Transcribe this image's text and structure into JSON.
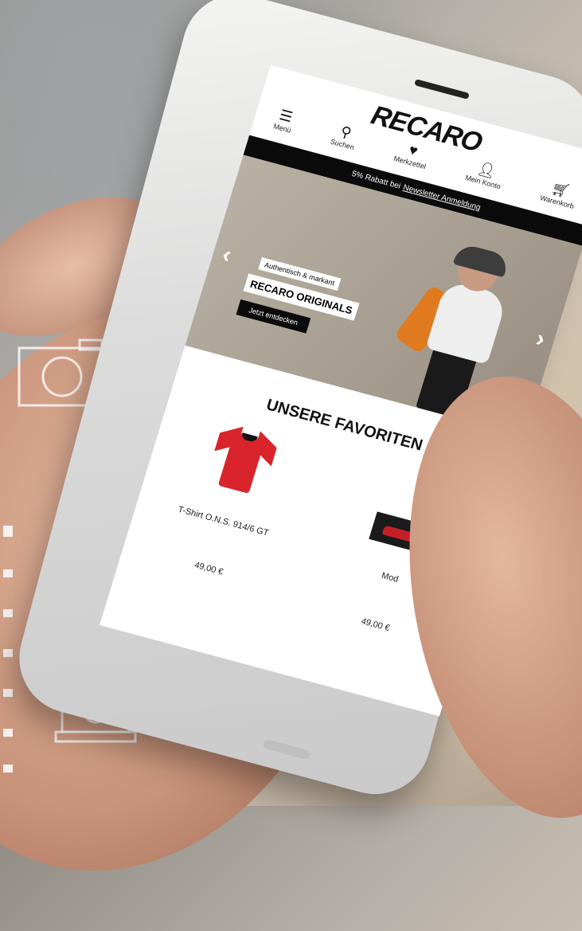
{
  "app": {
    "logo": "RECARO"
  },
  "nav": [
    {
      "label": "Menü",
      "icon": "menu-icon"
    },
    {
      "label": "Suchen",
      "icon": "search-icon"
    },
    {
      "label": "Merkzettel",
      "icon": "heart-icon"
    },
    {
      "label": "Mein Konto",
      "icon": "user-icon"
    },
    {
      "label": "Warenkorb",
      "icon": "cart-icon"
    }
  ],
  "promo": {
    "text": "5% Rabatt bei",
    "link": "Newsletter Anmeldung"
  },
  "hero": {
    "tagline": "Authentisch & markant",
    "title": "RECARO ORIGINALS",
    "cta": "Jetzt entdecken"
  },
  "favorites": {
    "title": "UNSERE FAVORITEN",
    "products": [
      {
        "name": "T-Shirt O.N.S. 914/6 GT",
        "price": "49,00 €"
      },
      {
        "name": "Mod",
        "price": "49,00 €"
      }
    ]
  },
  "colors": {
    "accent": "#d9242b",
    "hero_orange": "#e07a1e",
    "bar": "#0b0b0b"
  }
}
